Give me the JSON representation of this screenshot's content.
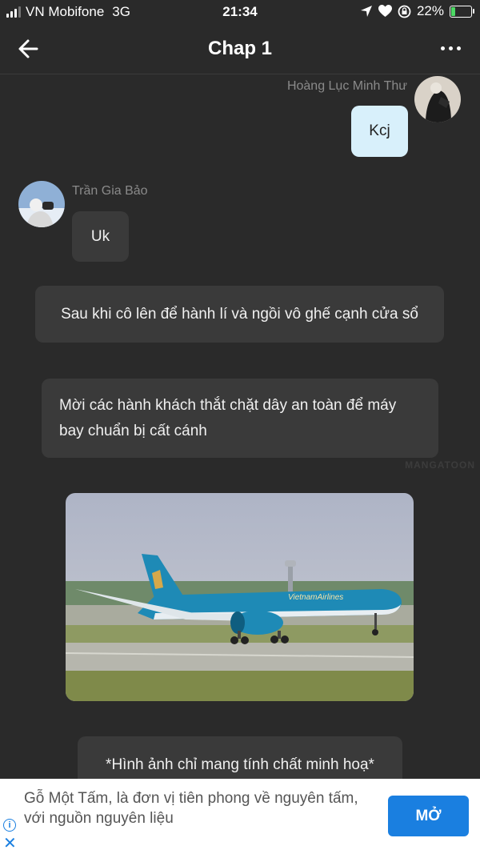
{
  "status": {
    "carrier": "VN Mobifone",
    "network": "3G",
    "time": "21:34",
    "battery": "22%",
    "battery_level": 0.22
  },
  "nav": {
    "title": "Chap 1"
  },
  "messages": {
    "m1": {
      "sender": "Hoàng Lục Minh Thư",
      "text": "Kcj"
    },
    "m2": {
      "sender": "Trần Gia Bảo",
      "text": "Uk"
    }
  },
  "narration": {
    "n1": "Sau khi cô lên để hành lí và ngồi vô ghế cạnh cửa sổ",
    "n2": "Mời các hành khách thắt chặt dây an toàn để máy bay chuẩn bị cất cánh",
    "n3": "*Hình ảnh chỉ mang tính chất minh hoạ*"
  },
  "watermark": "MANGATOON",
  "photo": {
    "livery_text": "VietnamAirlines"
  },
  "ad": {
    "text": "Gỗ Một Tấm, là đơn vị tiên phong về nguyên tấm, với nguồn nguyên liệu",
    "button": "MỞ"
  },
  "icons": {
    "back": "arrow-left-icon",
    "more": "ellipsis-icon",
    "location": "location-arrow-icon",
    "heart": "heart-icon",
    "rotation_lock": "rotation-lock-icon",
    "battery": "battery-icon",
    "ad_info": "info-icon",
    "ad_close": "close-icon"
  },
  "colors": {
    "background": "#2a2a2a",
    "my_bubble": "#d8f0fb",
    "other_bubble": "#3a3a3a",
    "ad_button": "#1a7fe0"
  }
}
